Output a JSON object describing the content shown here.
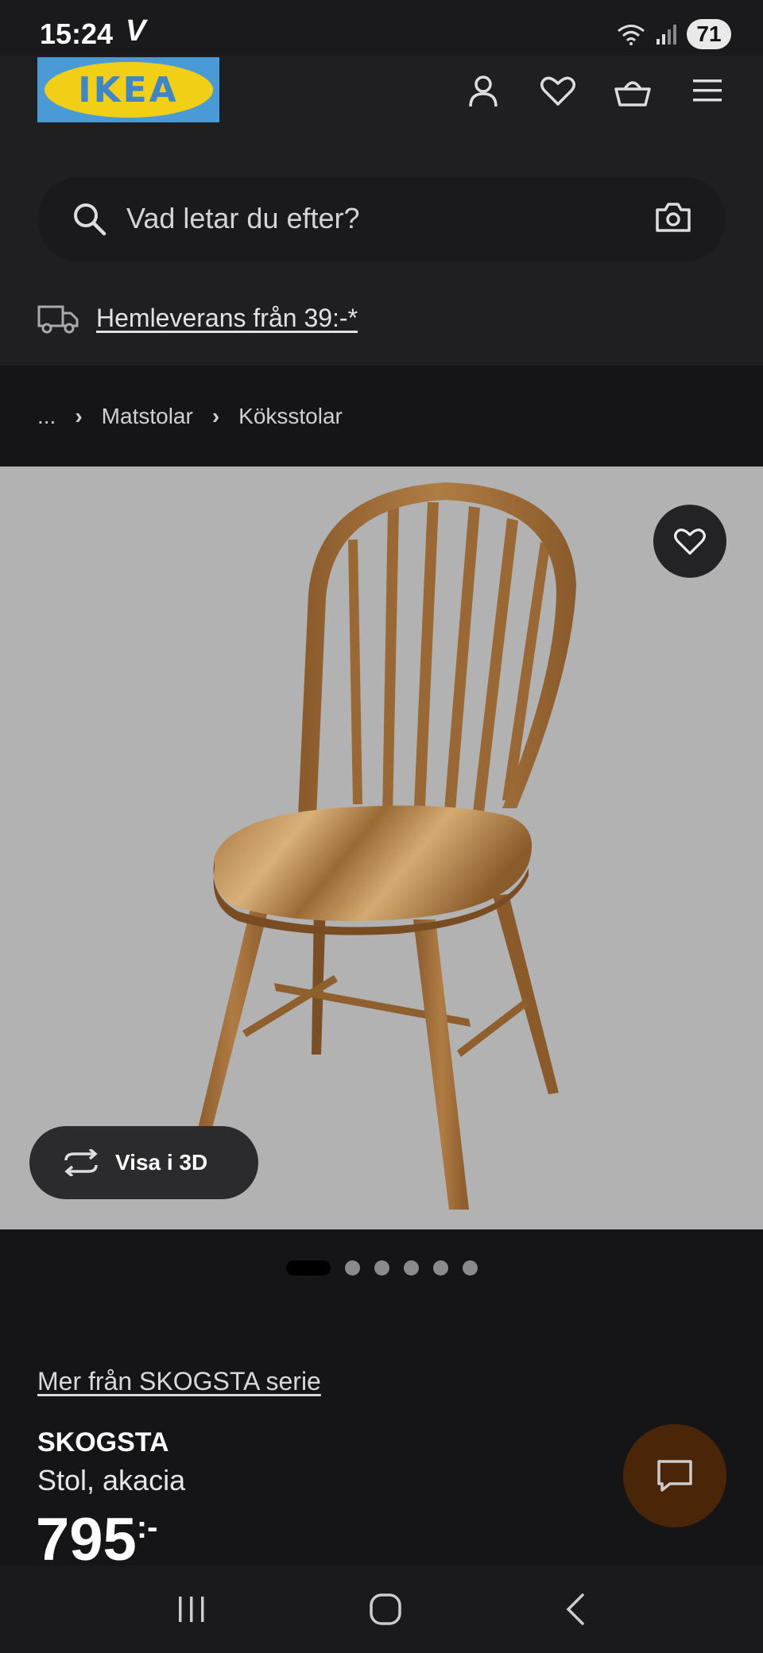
{
  "status_bar": {
    "time": "15:24",
    "carrier_glyph": "V",
    "battery": "71",
    "icons": [
      "wifi-icon",
      "signal-icon",
      "battery-icon"
    ]
  },
  "header": {
    "logo_text": "IKEA",
    "icons": [
      "user-icon",
      "heart-icon",
      "basket-icon",
      "menu-icon"
    ]
  },
  "search": {
    "placeholder": "Vad letar du efter?",
    "icons": [
      "search-icon",
      "camera-icon"
    ]
  },
  "delivery": {
    "label": "Hemleverans från 39:-*",
    "icon": "truck-icon"
  },
  "breadcrumb": {
    "items": [
      "...",
      "Matstolar",
      "Köksstolar"
    ]
  },
  "gallery": {
    "view_3d_label": "Visa i 3D",
    "total_images": 6,
    "active_index": 0
  },
  "product": {
    "series_link": "Mer från SKOGSTA serie",
    "name": "SKOGSTA",
    "description": "Stol, akacia",
    "price": "795",
    "price_suffix": ":-"
  },
  "colors": {
    "background": "#151517",
    "header": "#1f1f22",
    "ikea_blue": "#4a9ad6",
    "ikea_yellow": "#f2cf17",
    "image_bg": "#b2b2b2",
    "chat_button": "#4a2508"
  }
}
